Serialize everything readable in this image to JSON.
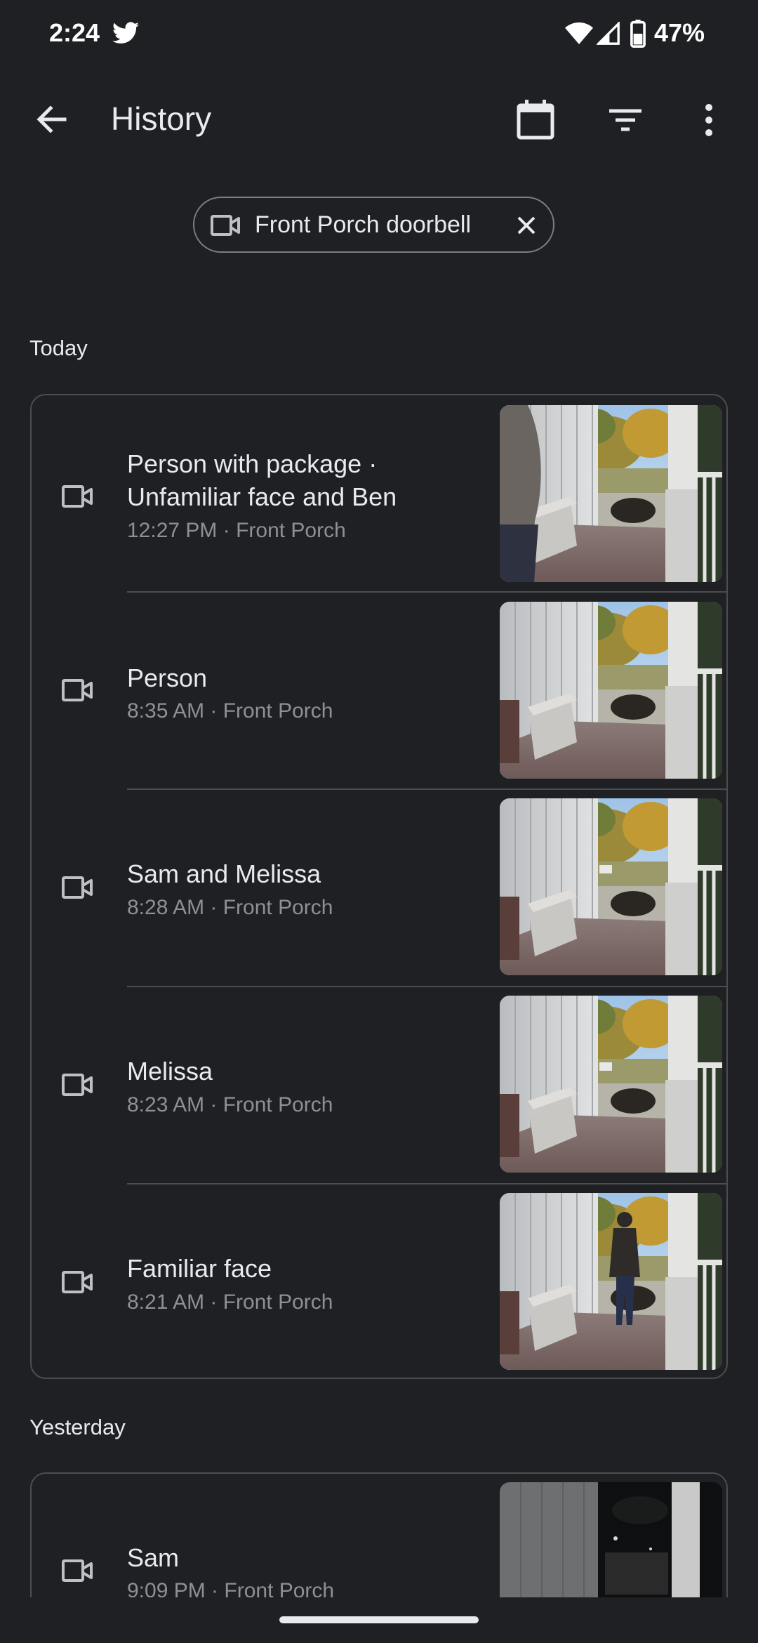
{
  "status": {
    "time": "2:24",
    "battery": "47%"
  },
  "appbar": {
    "title": "History"
  },
  "filter_chip": {
    "label": "Front Porch doorbell"
  },
  "sections": [
    {
      "label": "Today",
      "events": [
        {
          "title": "Person with package · Unfamiliar face and Ben",
          "subtitle": "12:27 PM · Front Porch"
        },
        {
          "title": "Person",
          "subtitle": "8:35 AM · Front Porch"
        },
        {
          "title": "Sam and Melissa",
          "subtitle": "8:28 AM · Front Porch"
        },
        {
          "title": "Melissa",
          "subtitle": "8:23 AM · Front Porch"
        },
        {
          "title": "Familiar face",
          "subtitle": "8:21 AM · Front Porch"
        }
      ]
    },
    {
      "label": "Yesterday",
      "events": [
        {
          "title": "Sam",
          "subtitle": "9:09 PM · Front Porch"
        }
      ]
    }
  ],
  "icons": {
    "back": "arrow-back-icon",
    "calendar": "calendar-icon",
    "filter": "filter-icon",
    "more": "more-vert-icon",
    "camera": "videocam-icon",
    "close": "close-icon"
  }
}
